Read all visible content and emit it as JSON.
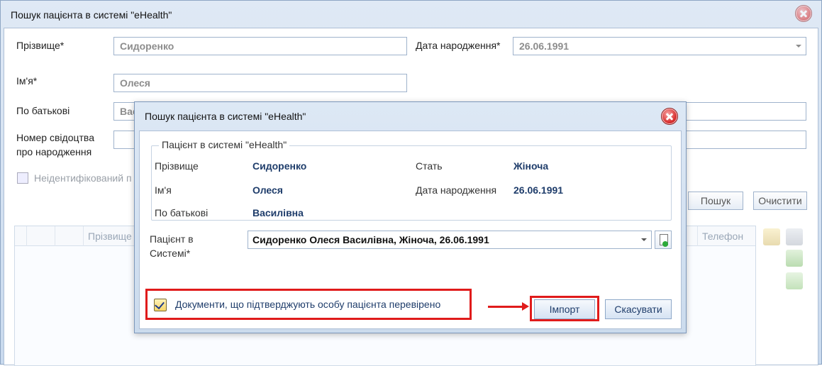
{
  "main_window": {
    "title": "Пошук пацієнта в системі \"eHealth\"",
    "labels": {
      "surname": "Прізвище*",
      "name": "Ім'я*",
      "patronymic": "По батькові",
      "birth_cert": "Номер свідоцтва про народження",
      "dob": "Дата народження*",
      "unidentified": "Неідентифікований п"
    },
    "values": {
      "surname": "Сидоренко",
      "name": "Олеся",
      "patronymic": "Вас",
      "dob": "26.06.1991"
    },
    "buttons": {
      "search": "Пошук",
      "clear": "Очистити"
    },
    "grid": {
      "col_surname": "Прізвище",
      "col_phone": "Телефон"
    }
  },
  "dialog": {
    "title": "Пошук пацієнта в системі \"eHealth\"",
    "group_title": "Пацієнт в системі \"eHealth\"",
    "fields": {
      "surname_label": "Прізвище",
      "surname_value": "Сидоренко",
      "name_label": "Ім'я",
      "name_value": "Олеся",
      "patronymic_label": "По батькові",
      "patronymic_value": "Василівна",
      "gender_label": "Стать",
      "gender_value": "Жіноча",
      "dob_label": "Дата народження",
      "dob_value": "26.06.1991"
    },
    "patient_label": "Пацієнт в Системі*",
    "patient_value": "Сидоренко Олеся Василівна, Жіноча, 26.06.1991",
    "checkbox_label": "Документи, що підтверджують особу пацієнта перевірено",
    "checkbox_checked": true,
    "buttons": {
      "import": "Імпорт",
      "cancel": "Скасувати"
    }
  },
  "colors": {
    "highlight": "#e01b1b",
    "accent_text": "#1f3d6b"
  }
}
